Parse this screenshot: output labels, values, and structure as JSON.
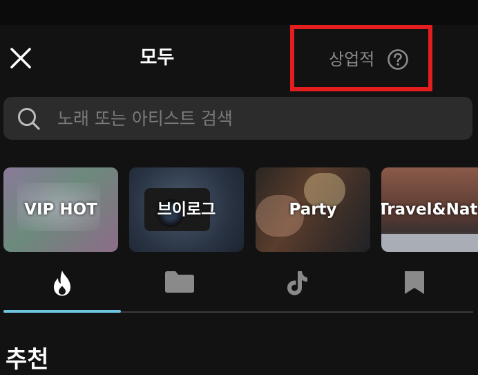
{
  "header": {
    "title": "모두",
    "commercial_label": "상업적"
  },
  "search": {
    "placeholder": "노래 또는 아티스트 검색"
  },
  "categories": [
    {
      "label": "VIP HOT"
    },
    {
      "label": "브이로그"
    },
    {
      "label": "Party"
    },
    {
      "label": "Travel&Nate"
    }
  ],
  "tabs": [
    {
      "icon": "flame-icon",
      "active": true
    },
    {
      "icon": "folder-icon",
      "active": false
    },
    {
      "icon": "tiktok-icon",
      "active": false
    },
    {
      "icon": "bookmark-icon",
      "active": false
    }
  ],
  "section": {
    "title": "추천"
  },
  "colors": {
    "background": "#121212",
    "highlight_box": "#e41e1e",
    "tab_indicator": "#6fc3e0",
    "search_bg": "#2c2c2c"
  }
}
